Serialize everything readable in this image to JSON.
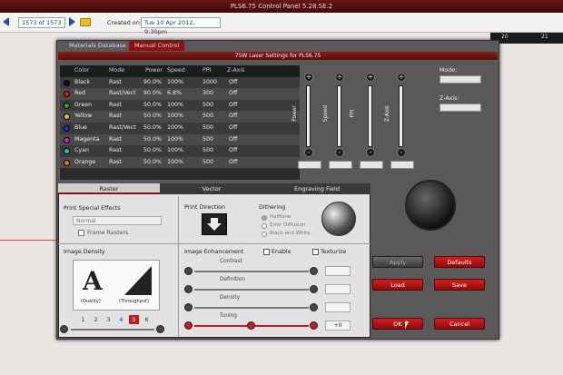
{
  "window": {
    "title": "PLS6.75    Control Panel    5.28.SE.2"
  },
  "toolbar": {
    "page_counter": "1573 of 1573",
    "created_label": "Created on:",
    "created_value": "Tue 10 Apr 2012,  9:30pm"
  },
  "ruler": {
    "marks": [
      "20",
      "21"
    ]
  },
  "tabs": {
    "materials": "Materials Database",
    "manual": "Manual Control"
  },
  "header": {
    "title": "75W Laser Settings for PLS6.75"
  },
  "table": {
    "columns": [
      "Color",
      "Mode",
      "Power",
      "Speed",
      "PPI",
      "Z-Axis"
    ],
    "rows": [
      {
        "color": "Black",
        "mode": "Rast",
        "power": "90.0%",
        "speed": "100%",
        "ppi": "1000",
        "z": "Off",
        "swatch": "#111111"
      },
      {
        "color": "Red",
        "mode": "Rast/Vect",
        "power": "90.0%",
        "speed": "6.8%",
        "ppi": "300",
        "z": "Off",
        "swatch": "#d11e1e"
      },
      {
        "color": "Green",
        "mode": "Rast",
        "power": "50.0%",
        "speed": "100%",
        "ppi": "500",
        "z": "Off",
        "swatch": "#29a329"
      },
      {
        "color": "Yellow",
        "mode": "Rast",
        "power": "50.0%",
        "speed": "100%",
        "ppi": "500",
        "z": "Off",
        "swatch": "#d4d21e"
      },
      {
        "color": "Blue",
        "mode": "Rast/Vect",
        "power": "50.0%",
        "speed": "100%",
        "ppi": "500",
        "z": "Off",
        "swatch": "#2233cc"
      },
      {
        "color": "Magenta",
        "mode": "Rast",
        "power": "50.0%",
        "speed": "100%",
        "ppi": "500",
        "z": "Off",
        "swatch": "#c62ec6"
      },
      {
        "color": "Cyan",
        "mode": "Rast",
        "power": "50.0%",
        "speed": "100%",
        "ppi": "500",
        "z": "Off",
        "swatch": "#1ec6c6"
      },
      {
        "color": "Orange",
        "mode": "Rast",
        "power": "50.0%",
        "speed": "100%",
        "ppi": "500",
        "z": "Off",
        "swatch": "#e07a1a"
      }
    ]
  },
  "sliders": {
    "power": "Power",
    "speed": "Speed",
    "ppi": "PPI",
    "z": "Z-Axis",
    "plus": "+",
    "minus": "-"
  },
  "side": {
    "mode_label": "Mode:",
    "zaxis_label": "Z-Axis:"
  },
  "lower_tabs": {
    "raster": "Raster",
    "vector": "Vector",
    "engraving": "Engraving Field"
  },
  "raster": {
    "print_special": "Print Special Effects",
    "normal": "Normal",
    "frame": "Frame Rasters",
    "print_direction": "Print Direction",
    "dithering": "Dithering",
    "dither_options": [
      "Halftone",
      "Error Diffusion",
      "Black and White"
    ],
    "image_density": "Image Density",
    "quality": "(Quality)",
    "throughput": "(Throughput)",
    "density_steps": [
      "1",
      "2",
      "3",
      "4",
      "5",
      "6"
    ],
    "density_selected": "5",
    "enhancement": "Image Enhancement",
    "enable": "Enable",
    "texturize": "Texturize",
    "contrast": "Contrast",
    "definition": "Definition",
    "density": "Density",
    "tuning": "Tuning",
    "tuning_value": "+0"
  },
  "buttons": {
    "apply": "Apply",
    "defaults": "Defaults",
    "load": "Load",
    "save": "Save",
    "ok": "OK",
    "cancel": "Cancel"
  }
}
